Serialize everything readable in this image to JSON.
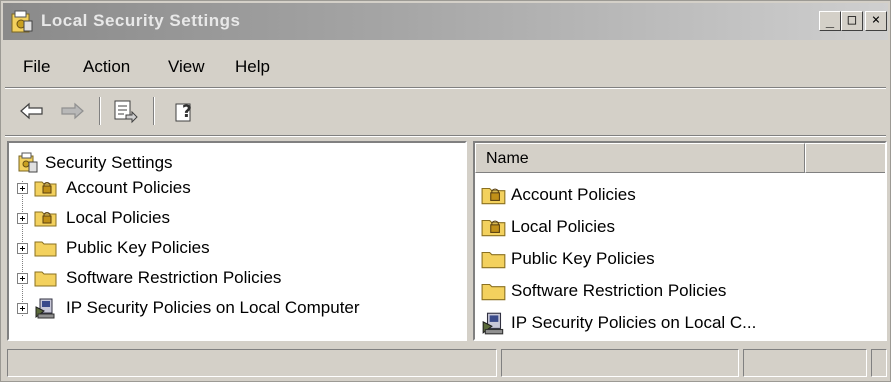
{
  "window": {
    "title": "Local Security Settings",
    "controls": {
      "minimize": "_",
      "maximize": "□",
      "close": "×"
    }
  },
  "menu": [
    "File",
    "Action",
    "View",
    "Help"
  ],
  "toolbar": {
    "back_icon": "back-arrow-icon",
    "forward_icon": "forward-arrow-icon",
    "export_icon": "export-list-icon",
    "help_icon": "help-icon"
  },
  "tree": {
    "root": "Security Settings",
    "items": [
      {
        "label": "Account Policies",
        "icon": "locked-folder-icon"
      },
      {
        "label": "Local Policies",
        "icon": "locked-folder-icon"
      },
      {
        "label": "Public Key Policies",
        "icon": "folder-icon"
      },
      {
        "label": "Software Restriction Policies",
        "icon": "folder-icon"
      },
      {
        "label": "IP Security Policies on Local Computer",
        "icon": "ip-security-icon"
      }
    ]
  },
  "list": {
    "columns": [
      "Name",
      ""
    ],
    "items": [
      {
        "label": "Account Policies",
        "icon": "locked-folder-icon"
      },
      {
        "label": "Local Policies",
        "icon": "locked-folder-icon"
      },
      {
        "label": "Public Key Policies",
        "icon": "folder-icon"
      },
      {
        "label": "Software Restriction Policies",
        "icon": "folder-icon"
      },
      {
        "label": "IP Security Policies on Local C...",
        "icon": "ip-security-icon"
      }
    ]
  },
  "colors": {
    "chrome": "#d4d0c8",
    "titlebar_inactive": "#a6a6a6",
    "folder": "#f3d15e"
  }
}
